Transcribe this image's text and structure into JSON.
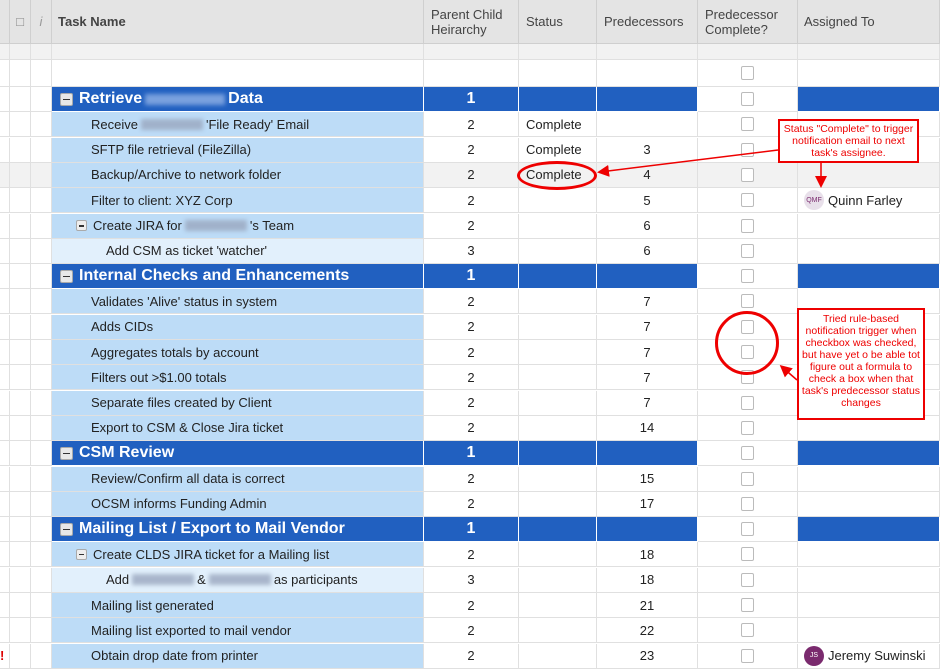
{
  "headers": {
    "task": "Task Name",
    "parent_child": "Parent Child Heirarchy",
    "status": "Status",
    "predecessors": "Predecessors",
    "pred_complete": "Predecessor Complete?",
    "assigned": "Assigned To"
  },
  "rows": [
    {
      "type": "parent",
      "a": "Retrieve",
      "blur": true,
      "b": "Data",
      "pc": "1",
      "status": "",
      "pred": "",
      "assigned": ""
    },
    {
      "type": "lvl2",
      "a": "Receive",
      "blur": true,
      "b": "'File Ready' Email",
      "pc": "2",
      "status": "Complete",
      "pred": "",
      "assigned": ""
    },
    {
      "type": "lvl2",
      "a": "SFTP file retrieval (FileZilla)",
      "pc": "2",
      "status": "Complete",
      "pred": "3",
      "assigned": ""
    },
    {
      "type": "lvl2",
      "a": "Backup/Archive to network folder",
      "pc": "2",
      "status": "Complete",
      "pred": "4",
      "assigned": "",
      "grey": true
    },
    {
      "type": "lvl2",
      "a": "Filter to client: XYZ Corp",
      "pc": "2",
      "status": "",
      "pred": "5",
      "assigned": "Quinn Farley",
      "avatar": "QMF",
      "avatar_color": "#e8e0ea"
    },
    {
      "type": "lvl2",
      "toggle": true,
      "a": "Create JIRA for",
      "blur": true,
      "b": "'s Team",
      "pc": "2",
      "status": "",
      "pred": "6",
      "assigned": ""
    },
    {
      "type": "lvl3",
      "a": "Add CSM as ticket 'watcher'",
      "pc": "3",
      "status": "",
      "pred": "6",
      "assigned": ""
    },
    {
      "type": "parent",
      "a": "Internal Checks and Enhancements",
      "pc": "1",
      "status": "",
      "pred": "",
      "assigned": ""
    },
    {
      "type": "lvl2",
      "a": "Validates 'Alive' status in system",
      "pc": "2",
      "status": "",
      "pred": "7",
      "assigned": ""
    },
    {
      "type": "lvl2",
      "a": "Adds CIDs",
      "pc": "2",
      "status": "",
      "pred": "7",
      "assigned": ""
    },
    {
      "type": "lvl2",
      "a": "Aggregates totals by account",
      "pc": "2",
      "status": "",
      "pred": "7",
      "assigned": ""
    },
    {
      "type": "lvl2",
      "a": "Filters out >$1.00 totals",
      "pc": "2",
      "status": "",
      "pred": "7",
      "assigned": ""
    },
    {
      "type": "lvl2",
      "a": "Separate files created by Client",
      "pc": "2",
      "status": "",
      "pred": "7",
      "assigned": ""
    },
    {
      "type": "lvl2",
      "a": "Export to CSM & Close Jira ticket",
      "pc": "2",
      "status": "",
      "pred": "14",
      "assigned": ""
    },
    {
      "type": "parent",
      "a": "CSM Review",
      "pc": "1",
      "status": "",
      "pred": "",
      "assigned": ""
    },
    {
      "type": "lvl2",
      "a": "Review/Confirm all data is correct",
      "pc": "2",
      "status": "",
      "pred": "15",
      "assigned": ""
    },
    {
      "type": "lvl2",
      "a": "OCSM informs Funding Admin",
      "pc": "2",
      "status": "",
      "pred": "17",
      "assigned": ""
    },
    {
      "type": "parent",
      "a": "Mailing List / Export to Mail Vendor",
      "pc": "1",
      "status": "",
      "pred": "",
      "assigned": ""
    },
    {
      "type": "lvl2",
      "toggle": true,
      "a": "Create CLDS JIRA ticket for a Mailing list",
      "pc": "2",
      "status": "",
      "pred": "18",
      "assigned": ""
    },
    {
      "type": "lvl3",
      "a": "Add",
      "blur": true,
      "b": "&",
      "blur2": true,
      "c": "as participants",
      "pc": "3",
      "status": "",
      "pred": "18",
      "assigned": ""
    },
    {
      "type": "lvl2",
      "a": "Mailing list generated",
      "pc": "2",
      "status": "",
      "pred": "21",
      "assigned": ""
    },
    {
      "type": "lvl2",
      "a": "Mailing list exported to mail vendor",
      "pc": "2",
      "status": "",
      "pred": "22",
      "assigned": ""
    },
    {
      "type": "lvl2",
      "a": "Obtain drop date from printer",
      "pc": "2",
      "status": "",
      "pred": "23",
      "assigned": "Jeremy Suwinski",
      "avatar": "JS",
      "avatar_color": "#7a2a6e",
      "flag": true
    }
  ],
  "notes": {
    "status_note": "Status \"Complete\" to trigger notification email to next task's assignee.",
    "checkbox_note": "Tried rule-based notification trigger when checkbox was checked, but have yet o be able tot figure out a formula to check a box when that task's predecessor status changes"
  },
  "colors": {
    "parent_row": "#2160c0",
    "child_row": "#bddcf7",
    "annotation": "#e00000"
  }
}
